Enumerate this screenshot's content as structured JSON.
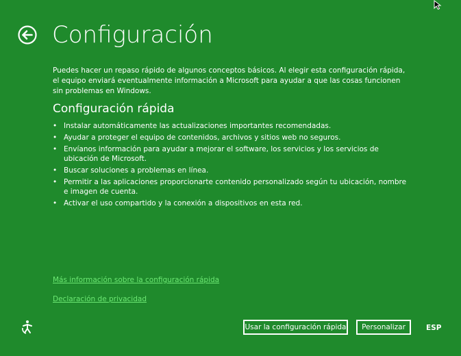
{
  "header": {
    "back_icon": "back-arrow-icon",
    "title": "Configuración"
  },
  "intro": "Puedes hacer un repaso rápido de algunos conceptos básicos. Al elegir esta configuración rápida, el equipo enviará eventualmente información a Microsoft para ayudar a que las cosas funcionen sin problemas en Windows.",
  "section": {
    "title": "Configuración rápida",
    "bullet_char": "•",
    "items": [
      "Instalar automáticamente las actualizaciones importantes recomendadas.",
      "Ayudar a proteger el equipo de contenidos, archivos y sitios web no seguros.",
      "Envíanos información para ayudar a mejorar el software, los servicios y los servicios de ubicación de Microsoft.",
      "Buscar soluciones a problemas en línea.",
      "Permitir a las aplicaciones proporcionarte contenido personalizado según tu ubicación, nombre e imagen de cuenta.",
      "Activar el uso compartido y la conexión a dispositivos en esta red."
    ]
  },
  "links": {
    "more_info": "Más información sobre la configuración rápida",
    "privacy": "Declaración de privacidad"
  },
  "footer": {
    "ease_of_access_icon": "ease-of-access-icon",
    "express_button": "Usar la configuración rápida",
    "customize_button": "Personalizar",
    "language": "ESP"
  },
  "colors": {
    "background": "#1f8a2c",
    "text": "#ffffff",
    "link": "#6ce873"
  }
}
